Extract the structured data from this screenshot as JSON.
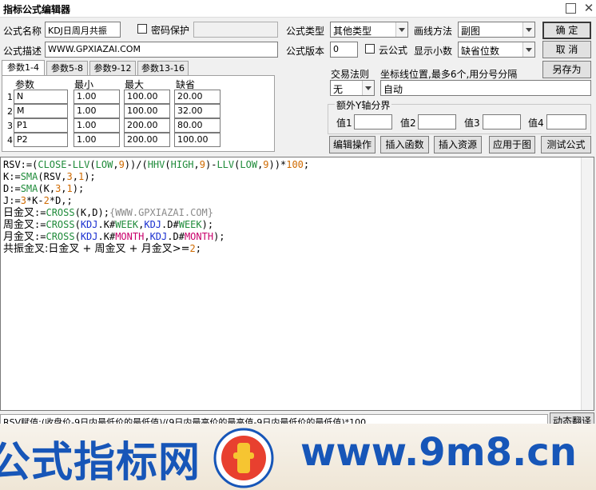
{
  "window": {
    "title": "指标公式编辑器",
    "close_glyph": "✕"
  },
  "form": {
    "name_label": "公式名称",
    "name_value": "KDJ日周月共振",
    "password_label": "密码保护",
    "desc_label": "公式描述",
    "desc_value": "WWW.GPXIAZAI.COM",
    "type_label": "公式类型",
    "type_value": "其他类型",
    "draw_label": "画线方法",
    "draw_value": "副图",
    "version_label": "公式版本",
    "version_value": "0",
    "cloud_label": "云公式",
    "decimals_label": "显示小数",
    "decimals_value": "缺省位数",
    "trade_rule_label": "交易法则",
    "trade_rule_value": "无",
    "coord_label": "坐标线位置,最多6个,用分号分隔",
    "coord_value": "自动",
    "extra_axis_label": "额外Y轴分界",
    "axis_values": [
      {
        "label": "值1",
        "value": ""
      },
      {
        "label": "值2",
        "value": ""
      },
      {
        "label": "值3",
        "value": ""
      },
      {
        "label": "值4",
        "value": ""
      }
    ]
  },
  "buttons": {
    "ok": "确  定",
    "cancel": "取  消",
    "save_as": "另存为",
    "edit_ops": "编辑操作",
    "insert_func": "插入函数",
    "insert_res": "插入资源",
    "apply_chart": "应用于图",
    "test_formula": "测试公式",
    "dynamic_translate": "动态翻译"
  },
  "tabs": [
    "参数1-4",
    "参数5-8",
    "参数9-12",
    "参数13-16"
  ],
  "params": {
    "headers": [
      "参数",
      "最小",
      "最大",
      "缺省"
    ],
    "rows": [
      {
        "num": "1",
        "name": "N",
        "min": "1.00",
        "max": "100.00",
        "def": "20.00"
      },
      {
        "num": "2",
        "name": "M",
        "min": "1.00",
        "max": "100.00",
        "def": "32.00"
      },
      {
        "num": "3",
        "name": "P1",
        "min": "1.00",
        "max": "200.00",
        "def": "80.00"
      },
      {
        "num": "4",
        "name": "P2",
        "min": "1.00",
        "max": "200.00",
        "def": "100.00"
      }
    ]
  },
  "code": {
    "l1": [
      "RSV:=(",
      "CLOSE",
      "-",
      "LLV",
      "(",
      "LOW",
      ",",
      "9",
      "))/(",
      "HHV",
      "(",
      "HIGH",
      ",",
      "9",
      ")-",
      "LLV",
      "(",
      "LOW",
      ",",
      "9",
      "))*",
      "100",
      ";"
    ],
    "l2": [
      "K:=",
      "SMA",
      "(RSV,",
      "3",
      ",",
      "1",
      ");"
    ],
    "l3": [
      "D:=",
      "SMA",
      "(K,",
      "3",
      ",",
      "1",
      ");"
    ],
    "l4": [
      "J:=",
      "3",
      "*K-",
      "2",
      "*D,;"
    ],
    "l5": [
      "日金叉",
      ":=",
      "CROSS",
      "(K,D);",
      "{WWW.GPXIAZAI.COM}"
    ],
    "l6": [
      "周金叉",
      ":=",
      "CROSS",
      "(",
      "KDJ",
      ".K#",
      "WEEK",
      ",",
      "KDJ",
      ".D#",
      "WEEK",
      ");"
    ],
    "l7": [
      "月金叉",
      ":=",
      "CROSS",
      "(",
      "KDJ",
      ".K#",
      "MONTH",
      ",",
      "KDJ",
      ".D#",
      "MONTH",
      ");"
    ],
    "l8": [
      "共振金叉",
      ":日金叉 + 周金叉 + 月金叉>=",
      "2",
      ";"
    ]
  },
  "status_text": "RSV赋值:(收盘价-9日内最低价的最低值)/(9日内最高价的最高值-9日内最低价的最低值)*100",
  "banner": {
    "left_text": "公式指标网",
    "right_text": "www.9m8.cn"
  },
  "colors": {
    "brand_blue": "#1756b8",
    "function_green": "#1f8b3a",
    "number_orange": "#cf6a00",
    "keyword_blue": "#1a2fd0"
  }
}
